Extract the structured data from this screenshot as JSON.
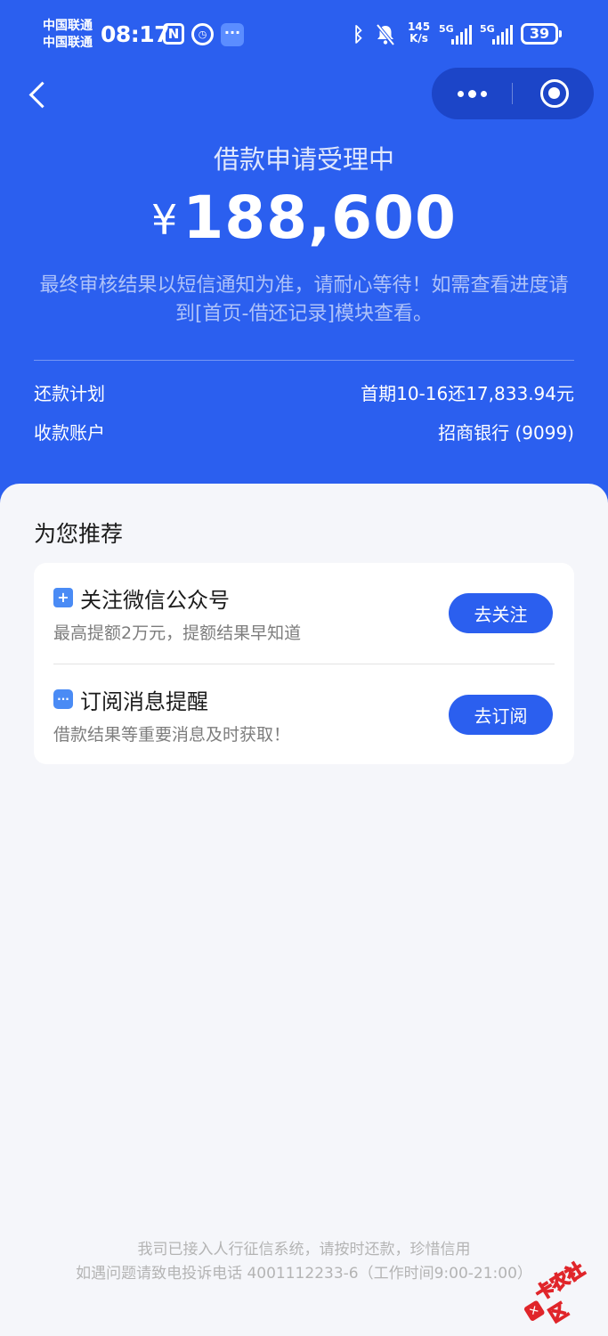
{
  "status_bar": {
    "carrier_1": "中国联通",
    "carrier_2": "中国联通",
    "time": "08:17",
    "nfc": "N",
    "net_speed_value": "145",
    "net_speed_unit": "K/s",
    "sim1_label": "5G",
    "sim2_label": "5G",
    "battery": "39"
  },
  "header": {
    "title": "借款申请受理中",
    "currency": "¥",
    "amount": "188,600",
    "notice": "最终审核结果以短信通知为准，请耐心等待！如需查看进度请到[首页-借还记录]模块查看。"
  },
  "details": {
    "repayment_plan_label": "还款计划",
    "repayment_plan_value": "首期10-16还17,833.94元",
    "account_label": "收款账户",
    "account_value": "招商银行 (9099)"
  },
  "recommend": {
    "title": "为您推荐",
    "items": [
      {
        "icon": "plus-square-icon",
        "name": "关注微信公众号",
        "desc": "最高提额2万元，提额结果早知道",
        "button": "去关注"
      },
      {
        "icon": "chat-bubble-icon",
        "name": "订阅消息提醒",
        "desc": "借款结果等重要消息及时获取！",
        "button": "去订阅"
      }
    ]
  },
  "footer": {
    "line1": "我司已接入人行征信系统，请按时还款，珍惜信用",
    "line2": "如遇问题请致电投诉电话 4001112233-6（工作时间9:00-21:00）"
  },
  "watermark": {
    "text": "卡农社区"
  },
  "colors": {
    "brand_blue": "#2b5fef",
    "background": "#f5f6fa",
    "button_blue": "#2b5fef"
  }
}
